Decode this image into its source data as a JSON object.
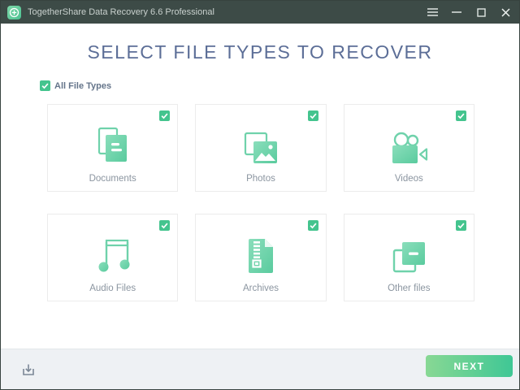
{
  "window": {
    "title": "TogetherShare Data Recovery 6.6 Professional",
    "app_icon": "plus-circle-icon",
    "controls": [
      {
        "name": "menu-icon"
      },
      {
        "name": "minimize-icon"
      },
      {
        "name": "maximize-icon"
      },
      {
        "name": "close-icon"
      }
    ]
  },
  "main": {
    "heading": "SELECT FILE TYPES TO RECOVER",
    "all_file_types": {
      "label": "All File Types",
      "checked": true
    },
    "file_types": [
      {
        "label": "Documents",
        "icon": "documents-icon",
        "checked": true
      },
      {
        "label": "Photos",
        "icon": "photos-icon",
        "checked": true
      },
      {
        "label": "Videos",
        "icon": "videos-icon",
        "checked": true
      },
      {
        "label": "Audio Files",
        "icon": "audio-files-icon",
        "checked": true
      },
      {
        "label": "Archives",
        "icon": "archives-icon",
        "checked": true
      },
      {
        "label": "Other files",
        "icon": "other-files-icon",
        "checked": true
      }
    ]
  },
  "footer": {
    "download_icon": "download-icon",
    "next_label": "NEXT"
  },
  "colors": {
    "titlebar_bg": "#3d4b47",
    "heading_text": "#5c6e97",
    "accent_green": "#44c48e",
    "icon_mint_light": "#8adebb",
    "icon_mint_dark": "#5acb9e",
    "next_gradient_start": "#88d894",
    "next_gradient_end": "#3fc795",
    "footer_bg": "#eef1f4"
  }
}
